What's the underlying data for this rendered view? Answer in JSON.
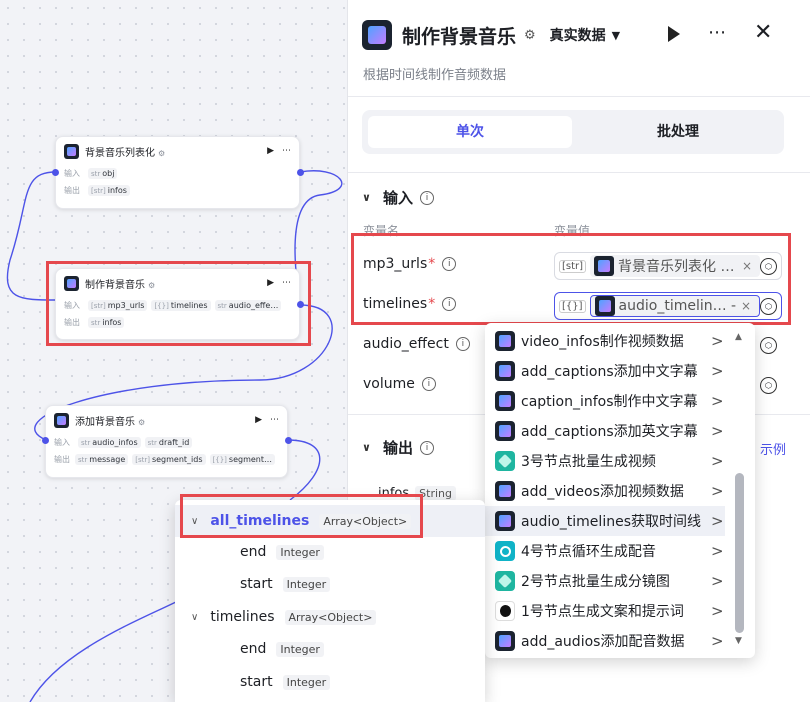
{
  "canvas": {
    "nodes": [
      {
        "title": "背景音乐列表化",
        "input_label": "输入",
        "output_label": "输出",
        "inputs": [
          {
            "type": "str",
            "name": "obj"
          }
        ],
        "outputs": [
          {
            "type": "[str]",
            "name": "infos"
          }
        ]
      },
      {
        "title": "制作背景音乐",
        "input_label": "输入",
        "output_label": "输出",
        "inputs": [
          {
            "type": "[str]",
            "name": "mp3_urls"
          },
          {
            "type": "[{}]",
            "name": "timelines"
          },
          {
            "type": "str",
            "name": "audio_effe…"
          }
        ],
        "outputs": [
          {
            "type": "str",
            "name": "infos"
          }
        ]
      },
      {
        "title": "添加背景音乐",
        "input_label": "输入",
        "output_label": "输出",
        "inputs": [
          {
            "type": "str",
            "name": "audio_infos"
          },
          {
            "type": "str",
            "name": "draft_id"
          }
        ],
        "outputs": [
          {
            "type": "str",
            "name": "message"
          },
          {
            "type": "[str]",
            "name": "segment_ids"
          },
          {
            "type": "[{}]",
            "name": "segment…"
          }
        ]
      }
    ]
  },
  "panel": {
    "title": "制作背景音乐",
    "mode": "真实数据",
    "description": "根据时间线制作音频数据",
    "tabs": [
      "单次",
      "批处理"
    ],
    "input_section": "输入",
    "col_name": "变量名",
    "col_value": "变量值",
    "fields": [
      {
        "name": "mp3_urls",
        "required": "*",
        "type": "[str]",
        "value": "背景音乐列表化 - i…"
      },
      {
        "name": "timelines",
        "required": "*",
        "type": "[{}]",
        "value": "audio_timelin… -"
      },
      {
        "name": "audio_effect",
        "required": "",
        "type": "",
        "value": ""
      },
      {
        "name": "volume",
        "required": "",
        "type": "",
        "value": ""
      }
    ],
    "output_section": "输出",
    "output_field": {
      "name": "infos",
      "type": "String"
    },
    "example_link": "示例"
  },
  "node_dropdown": {
    "items": [
      {
        "label": "video_infos制作视频数据",
        "icon": "app-icon"
      },
      {
        "label": "add_captions添加中文字幕",
        "icon": "app-icon"
      },
      {
        "label": "caption_infos制作中文字幕",
        "icon": "app-icon"
      },
      {
        "label": "add_captions添加英文字幕",
        "icon": "app-icon"
      },
      {
        "label": "3号节点批量生成视频",
        "icon": "batch-icon"
      },
      {
        "label": "add_videos添加视频数据",
        "icon": "app-icon"
      },
      {
        "label": "audio_timelines获取时间线",
        "icon": "app-icon"
      },
      {
        "label": "4号节点循环生成配音",
        "icon": "loop-icon"
      },
      {
        "label": "2号节点批量生成分镜图",
        "icon": "batch-icon"
      },
      {
        "label": "1号节点生成文案和提示词",
        "icon": "llm-icon"
      },
      {
        "label": "add_audios添加配音数据",
        "icon": "app-icon"
      }
    ]
  },
  "field_dropdown": {
    "items": [
      {
        "label": "all_timelines",
        "type": "Array<Object>",
        "level": 0
      },
      {
        "label": "end",
        "type": "Integer",
        "level": 1
      },
      {
        "label": "start",
        "type": "Integer",
        "level": 1
      },
      {
        "label": "timelines",
        "type": "Array<Object>",
        "level": 0
      },
      {
        "label": "end",
        "type": "Integer",
        "level": 1
      },
      {
        "label": "start",
        "type": "Integer",
        "level": 1
      }
    ]
  },
  "colors": {
    "accent": "#4d53e8",
    "highlight": "#e5484d"
  }
}
